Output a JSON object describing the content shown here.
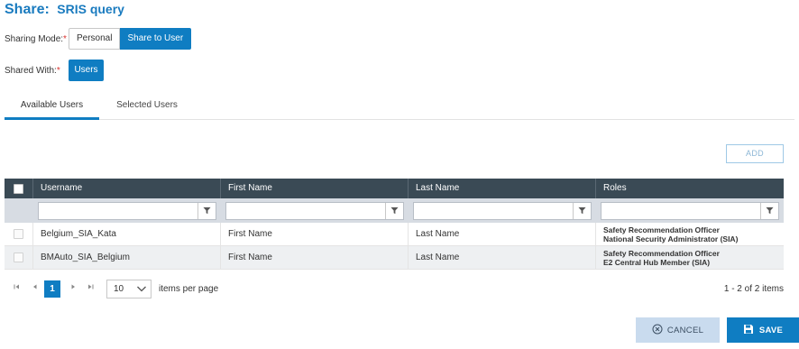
{
  "header": {
    "prefix": "Share:",
    "query_name": "SRIS query"
  },
  "sharing_mode": {
    "label": "Sharing Mode:",
    "required_mark": "*",
    "options": [
      "Personal",
      "Share to User"
    ],
    "selected": "Share to User"
  },
  "shared_with": {
    "label": "Shared With:",
    "required_mark": "*",
    "button_label": "Users"
  },
  "tabs": [
    {
      "label": "Available Users",
      "active": true
    },
    {
      "label": "Selected Users",
      "active": false
    }
  ],
  "add_button": {
    "label": "ADD"
  },
  "table": {
    "columns": [
      "Username",
      "First Name",
      "Last Name",
      "Roles"
    ],
    "rows": [
      {
        "username": "Belgium_SIA_Kata",
        "first_name": "First Name",
        "last_name": "Last Name",
        "roles": [
          "Safety Recommendation Officer",
          "National Security Administrator (SIA)"
        ]
      },
      {
        "username": "BMAuto_SIA_Belgium",
        "first_name": "First Name",
        "last_name": "Last Name",
        "roles": [
          "Safety Recommendation Officer",
          "E2 Central Hub Member (SIA)"
        ]
      }
    ]
  },
  "pager": {
    "current_page": "1",
    "page_size": "10",
    "items_per_page_label": "items per page",
    "info": "1 - 2 of 2 items"
  },
  "actions": {
    "cancel_label": "CANCEL",
    "save_label": "SAVE"
  },
  "colors": {
    "accent": "#0f7dc2",
    "header_bg": "#3a4a55",
    "filter_bg": "#d7dce3",
    "required": "#d9332f"
  }
}
